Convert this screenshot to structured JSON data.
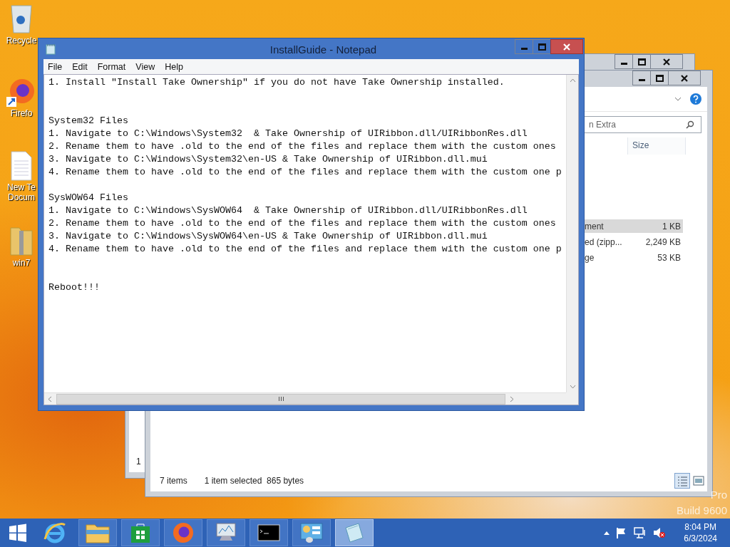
{
  "desktop_icons": [
    {
      "kind": "recycle",
      "label": [
        "Recycle"
      ]
    },
    {
      "kind": "firefox",
      "label": [
        "Firefo"
      ]
    },
    {
      "kind": "document",
      "label": [
        "New Te",
        "Docum"
      ]
    },
    {
      "kind": "zip",
      "label": [
        "win7"
      ]
    }
  ],
  "explorer_back": {
    "text": "1"
  },
  "explorer_front": {
    "search": {
      "placeholder": "n Extra"
    },
    "columns": [
      "Size"
    ],
    "rows": [
      {
        "name": "ment",
        "size": "1 KB",
        "selected": true
      },
      {
        "name": "ed (zipp...",
        "size": "2,249 KB",
        "selected": false
      },
      {
        "name": "ge",
        "size": "53 KB",
        "selected": false
      }
    ],
    "status": {
      "items": "7 items",
      "selection": "1 item selected  865 bytes"
    }
  },
  "notepad": {
    "title": "InstallGuide - Notepad",
    "menu": [
      "File",
      "Edit",
      "Format",
      "View",
      "Help"
    ],
    "blocks": [
      [
        "1. Install \"Install Take Ownership\" if you do not have Take Ownership installed."
      ],
      [
        "System32 Files",
        "1. Navigate to C:\\Windows\\System32  & Take Ownership of UIRibbon.dll/UIRibbonRes.dll",
        "2. Rename them to have .old to the end of the files and replace them with the custom ones",
        "3. Navigate to C:\\Windows\\System32\\en-US & Take Ownership of UIRibbon.dll.mui",
        "4. Rename them to have .old to the end of the files and replace them with the custom one p"
      ],
      [
        "SysWOW64 Files",
        "1. Navigate to C:\\Windows\\SysWOW64  & Take Ownership of UIRibbon.dll/UIRibbonRes.dll",
        "2. Rename them to have .old to the end of the files and replace them with the custom ones",
        "3. Navigate to C:\\Windows\\SysWOW64\\en-US & Take Ownership of UIRibbon.dll.mui",
        "4. Rename them to have .old to the end of the files and replace them with the custom one p"
      ],
      [
        "Reboot!!!"
      ]
    ]
  },
  "watermark": [
    "Pro",
    "Build 9600"
  ],
  "taskbar": {
    "items": [
      {
        "kind": "ie",
        "active": false
      },
      {
        "kind": "explorer",
        "active": false
      },
      {
        "kind": "store",
        "active": false
      },
      {
        "kind": "firefox",
        "active": false
      },
      {
        "kind": "monitor",
        "active": false
      },
      {
        "kind": "cmd",
        "active": false
      },
      {
        "kind": "control",
        "active": false
      },
      {
        "kind": "notepad",
        "active": true
      }
    ],
    "clock": {
      "time": "8:04 PM",
      "date": "6/3/2024"
    }
  }
}
